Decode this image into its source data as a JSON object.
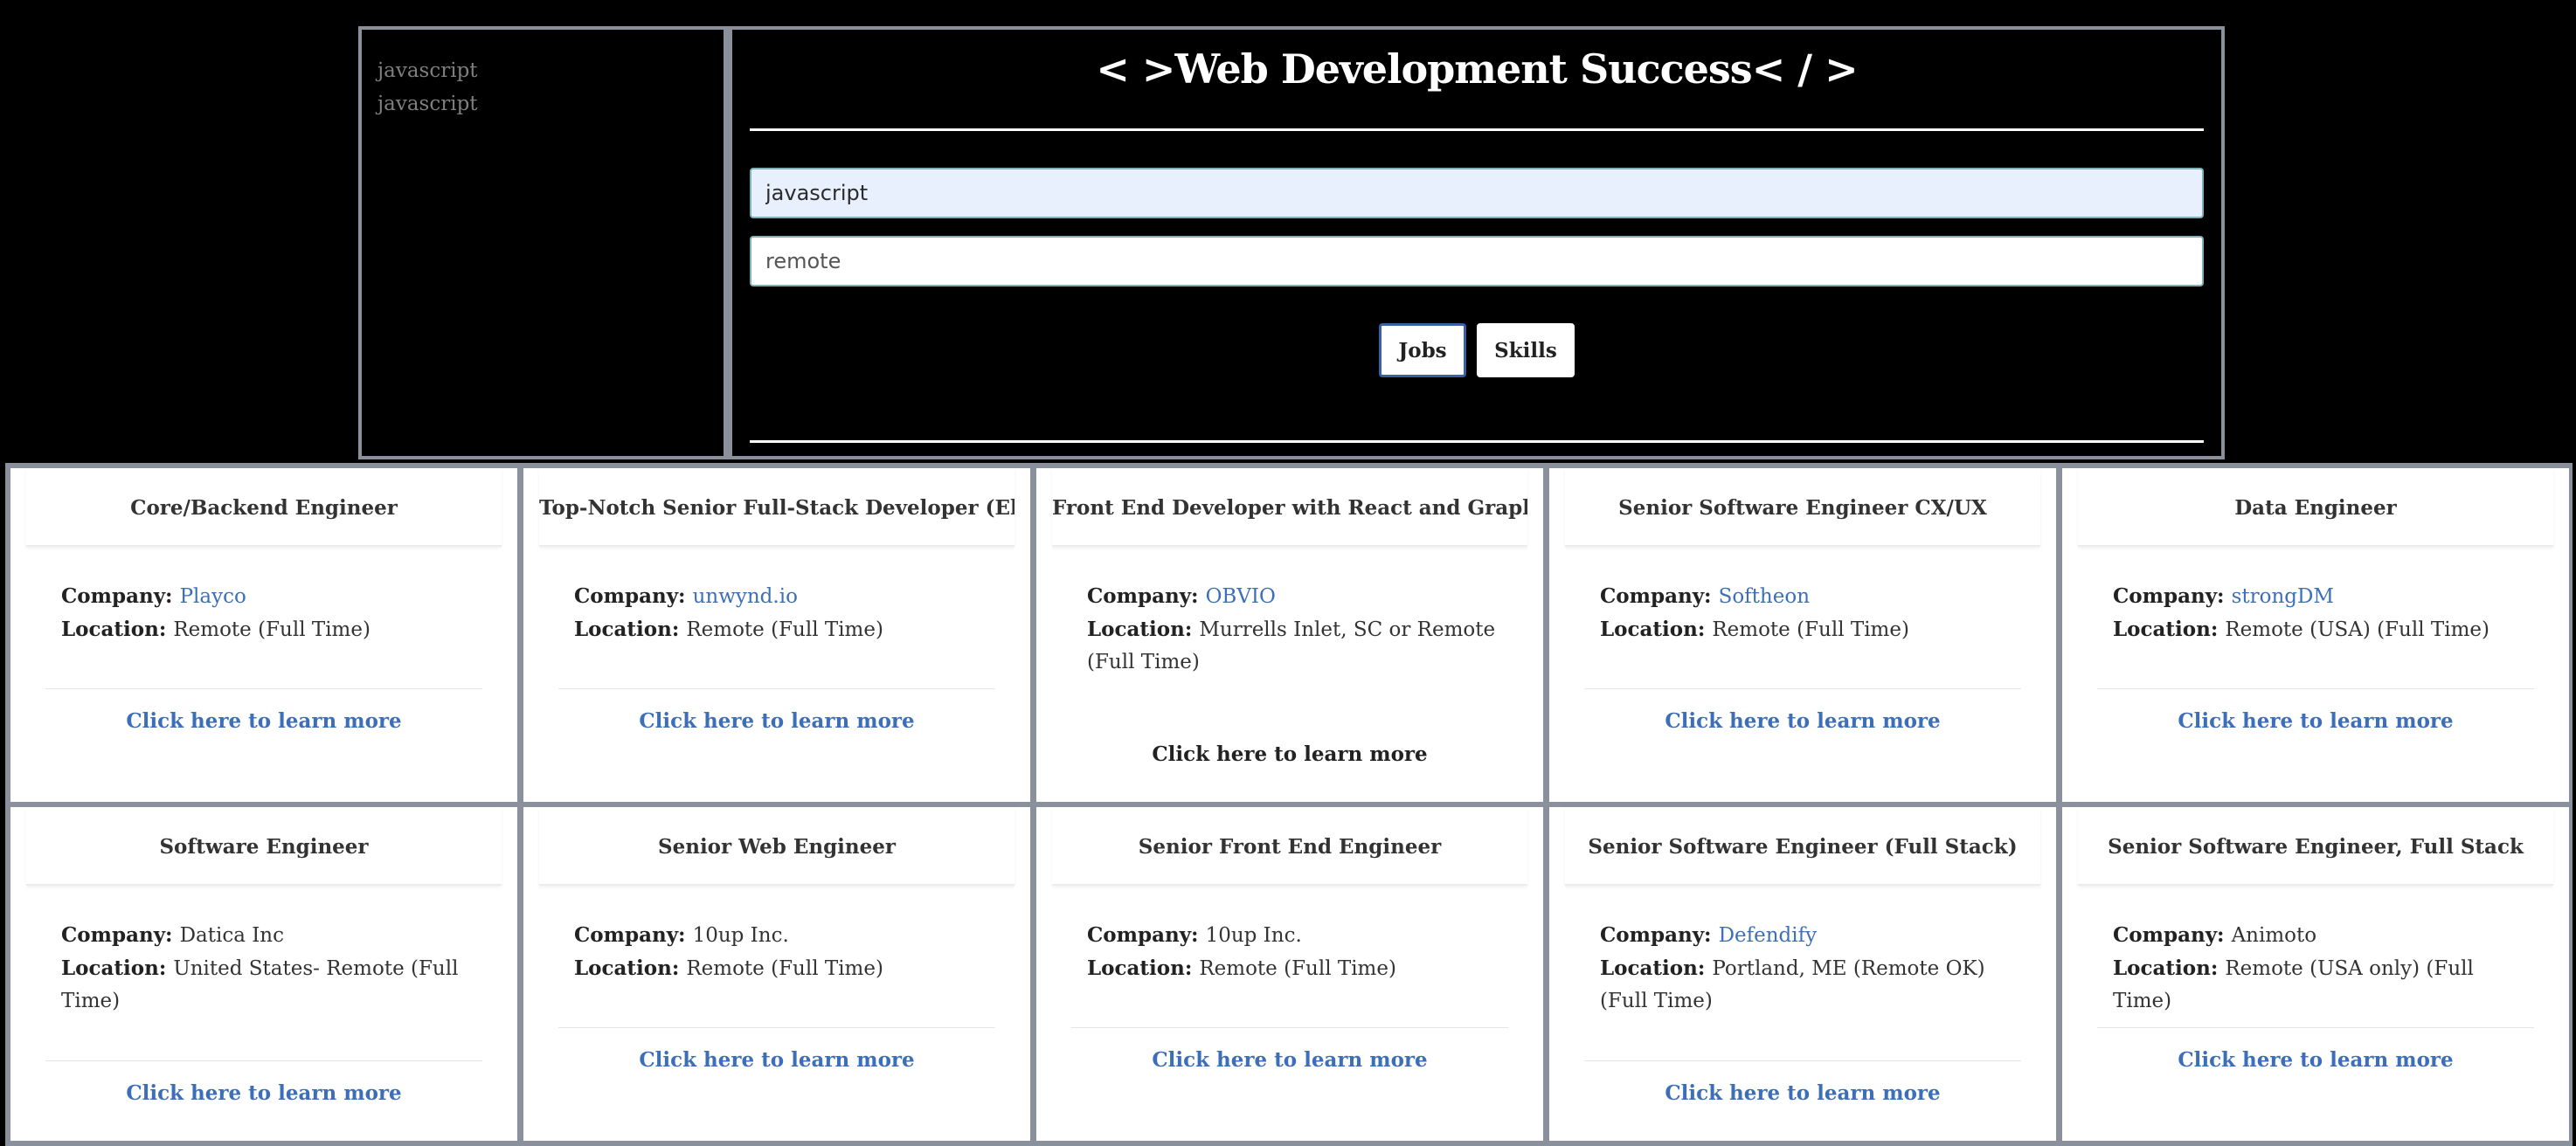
{
  "history": [
    "javascript",
    "javascript"
  ],
  "header": {
    "title": "< >Web Development Success< / >"
  },
  "search": {
    "keyword_value": "javascript",
    "location_placeholder": "remote"
  },
  "buttons": {
    "jobs_label": "Jobs",
    "skills_label": "Skills"
  },
  "labels": {
    "company": "Company: ",
    "location": "Location: "
  },
  "jobs": [
    {
      "title": "Core/Backend Engineer",
      "company": "Playco",
      "location": "Remote (Full Time)",
      "link": "Click here to learn more"
    },
    {
      "title": "Top-Notch Senior Full-Stack Developer (Electro",
      "company": "unwynd.io",
      "location": "Remote (Full Time)",
      "link": "Click here to learn more"
    },
    {
      "title": "Front End Developer with React and Graphic De",
      "company": "OBVIO",
      "location": "Murrells Inlet, SC or Remote (Full Time)",
      "link": "Click here to learn more"
    },
    {
      "title": "Senior Software Engineer CX/UX",
      "company": "Softheon",
      "location": "Remote (Full Time)",
      "link": "Click here to learn more"
    },
    {
      "title": "Data Engineer",
      "company": "strongDM",
      "location": "Remote (USA) (Full Time)",
      "link": "Click here to learn more"
    },
    {
      "title": "Software Engineer",
      "company": "Datica Inc",
      "location": "United States- Remote (Full Time)",
      "link": "Click here to learn more"
    },
    {
      "title": "Senior Web Engineer",
      "company": "10up Inc.",
      "location": "Remote (Full Time)",
      "link": "Click here to learn more"
    },
    {
      "title": "Senior Front End Engineer",
      "company": "10up Inc.",
      "location": "Remote (Full Time)",
      "link": "Click here to learn more"
    },
    {
      "title": "Senior Software Engineer (Full Stack)",
      "company": "Defendify",
      "location": "Portland, ME (Remote OK) (Full Time)",
      "link": "Click here to learn more"
    },
    {
      "title": "Senior Software Engineer, Full Stack",
      "company": "Animoto",
      "location": "Remote (USA only) (Full Time)",
      "link": "Click here to learn more"
    }
  ],
  "colors": {
    "background": "#000000",
    "panel_border": "#8a919c",
    "link": "#3d6fb8",
    "input_focus": "#e8f0fe"
  }
}
